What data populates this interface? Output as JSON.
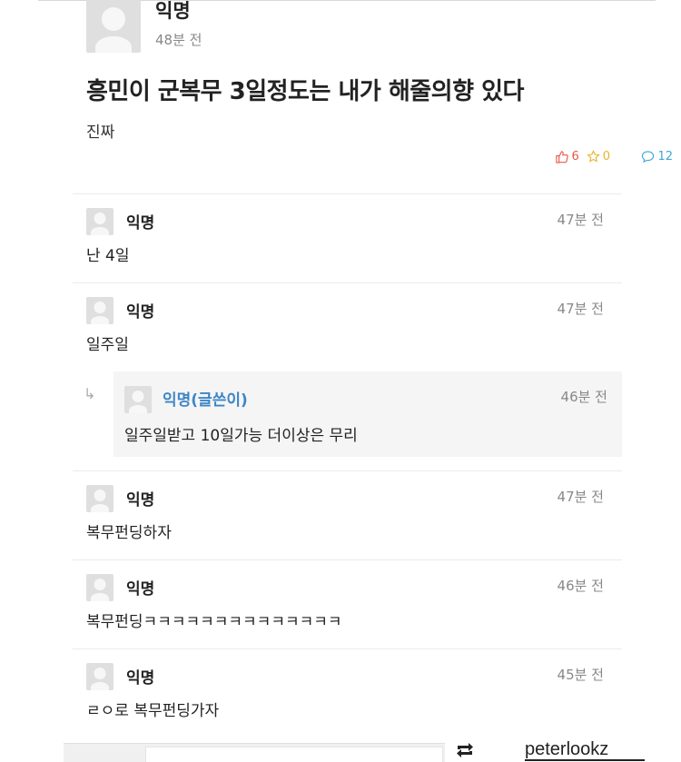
{
  "post": {
    "author": "익명",
    "time": "48분 전",
    "title": "흥민이 군복무 3일정도는 내가 해줄의향 있다",
    "body": "진짜",
    "stats": {
      "likes": "6",
      "comments": "12",
      "scraps": "0"
    }
  },
  "comments": [
    {
      "author": "익명",
      "time": "47분 전",
      "text": "난 4일"
    },
    {
      "author": "익명",
      "time": "47분 전",
      "text": "일주일"
    },
    {
      "author": "익명",
      "time": "47분 전",
      "text": "복무펀딩하자"
    },
    {
      "author": "익명",
      "time": "46분 전",
      "text": "복무펀딩ㅋㅋㅋㅋㅋㅋㅋㅋㅋㅋㅋㅋㅋㅋ"
    },
    {
      "author": "익명",
      "time": "45분 전",
      "text": "ㄹㅇ로 복무펀딩가자"
    }
  ],
  "reply": {
    "author": "익명(글쓴이)",
    "time": "46분 전",
    "text": "일주일받고 10일가능 더이상은 무리"
  },
  "watermark": {
    "username": "peterlookz",
    "icon": "repost-icon"
  },
  "colors": {
    "like": "#e35a4a",
    "comment": "#3fa7d6",
    "scrap": "#e9b32e",
    "reply_author": "#3d86c6"
  }
}
